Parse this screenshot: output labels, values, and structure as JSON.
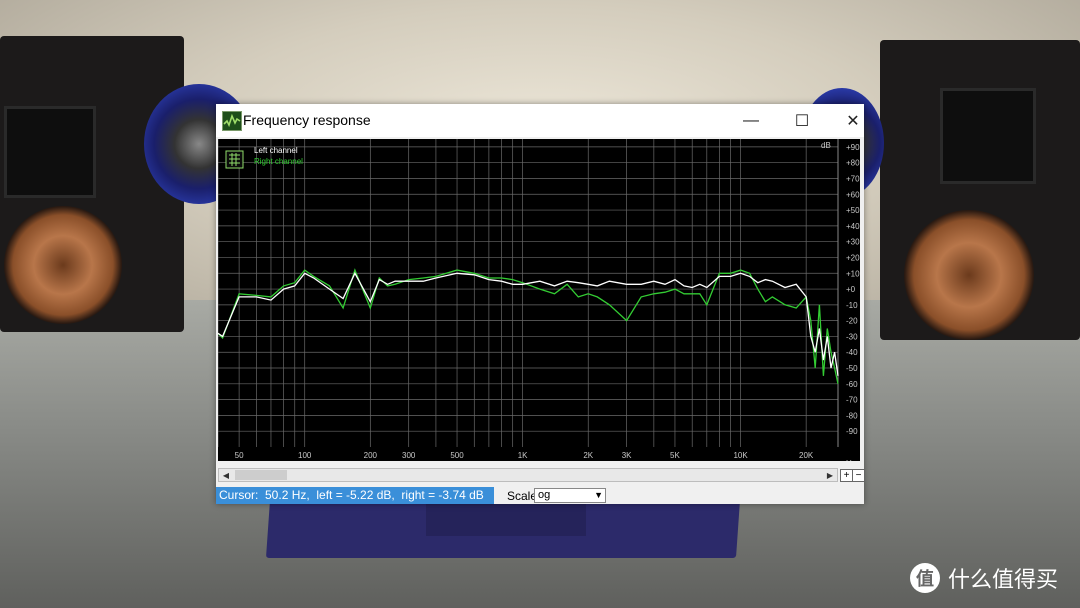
{
  "window": {
    "title": "Frequency response",
    "minimize_glyph": "—",
    "maximize_glyph": "☐",
    "close_glyph": "✕",
    "icon": "frequency-graph-icon"
  },
  "status": {
    "cursor_text": "Cursor:  50.2 Hz,  left = -5.22 dB,  right = -3.74 dB",
    "scale_label": "Scale",
    "scale_value": "og"
  },
  "watermark": {
    "logo": "值",
    "text": "什么值得买"
  },
  "colors": {
    "left_channel": "#ffffff",
    "right_channel": "#33cc33",
    "grid": "#6a6a6a",
    "background": "#000000",
    "status_highlight": "#3a8fd9"
  },
  "chart_data": {
    "type": "line",
    "x_scale": "log",
    "xlim": [
      40,
      28000
    ],
    "ylim": [
      -100,
      95
    ],
    "x_unit": "Hz",
    "y_unit": "dB",
    "x_tick_labels": [
      {
        "v": 50,
        "t": "50"
      },
      {
        "v": 100,
        "t": "100"
      },
      {
        "v": 200,
        "t": "200"
      },
      {
        "v": 300,
        "t": "300"
      },
      {
        "v": 500,
        "t": "500"
      },
      {
        "v": 1000,
        "t": "1K"
      },
      {
        "v": 2000,
        "t": "2K"
      },
      {
        "v": 3000,
        "t": "3K"
      },
      {
        "v": 5000,
        "t": "5K"
      },
      {
        "v": 10000,
        "t": "10K"
      },
      {
        "v": 20000,
        "t": "20K"
      }
    ],
    "y_ticks": [
      90,
      80,
      70,
      60,
      50,
      40,
      30,
      20,
      10,
      0,
      -10,
      -20,
      -30,
      -40,
      -50,
      -60,
      -70,
      -80,
      -90
    ],
    "y_tick_labels": [
      "+90",
      "+80",
      "+70",
      "+60",
      "+50",
      "+40",
      "+30",
      "+20",
      "+10",
      "+0",
      "-10",
      "-20",
      "-30",
      "-40",
      "-50",
      "-60",
      "-70",
      "-80",
      "-90"
    ],
    "grid": true,
    "legend_position": "top-left",
    "series": [
      {
        "name": "Left channel",
        "x": [
          40,
          42,
          50,
          60,
          70,
          80,
          90,
          100,
          110,
          130,
          150,
          170,
          200,
          220,
          240,
          260,
          300,
          350,
          400,
          500,
          600,
          700,
          800,
          900,
          1000,
          1200,
          1400,
          1600,
          1800,
          2000,
          2200,
          2500,
          3000,
          3500,
          4000,
          4500,
          5000,
          5500,
          6000,
          6500,
          7000,
          8000,
          9000,
          10000,
          11000,
          12000,
          13000,
          14000,
          16000,
          18000,
          20000,
          21000,
          22000,
          23000,
          24000,
          25000,
          26000,
          27000,
          28000
        ],
        "y": [
          -28,
          -30,
          -5,
          -5,
          -7,
          0,
          2,
          10,
          7,
          0,
          -6,
          10,
          -8,
          6,
          3,
          5,
          5,
          5,
          7,
          10,
          9,
          6,
          5,
          3,
          3,
          5,
          2,
          5,
          4,
          3,
          2,
          5,
          3,
          3,
          5,
          3,
          6,
          2,
          1,
          3,
          1,
          8,
          8,
          10,
          8,
          4,
          6,
          5,
          1,
          3,
          -5,
          -30,
          -40,
          -25,
          -45,
          -30,
          -50,
          -40,
          -55
        ]
      },
      {
        "name": "Right channel",
        "x": [
          40,
          42,
          50,
          60,
          70,
          80,
          90,
          100,
          110,
          130,
          150,
          170,
          200,
          220,
          240,
          260,
          300,
          350,
          400,
          500,
          600,
          700,
          800,
          900,
          1000,
          1200,
          1400,
          1600,
          1800,
          2000,
          2200,
          2500,
          3000,
          3500,
          4000,
          4500,
          5000,
          5500,
          6000,
          6500,
          7000,
          8000,
          9000,
          10000,
          11000,
          12000,
          13000,
          14000,
          16000,
          18000,
          20000,
          21000,
          22000,
          23000,
          24000,
          25000,
          26000,
          27000,
          28000
        ],
        "y": [
          -28,
          -31,
          -3,
          -4,
          -5,
          2,
          4,
          12,
          8,
          2,
          -12,
          12,
          -12,
          7,
          2,
          3,
          6,
          7,
          8,
          12,
          10,
          7,
          7,
          6,
          4,
          0,
          -3,
          3,
          -5,
          -3,
          -5,
          -10,
          -20,
          -5,
          -3,
          -2,
          0,
          -3,
          -3,
          -3,
          -10,
          10,
          10,
          12,
          10,
          0,
          -8,
          -5,
          -10,
          -12,
          -5,
          -20,
          -50,
          -10,
          -55,
          -25,
          -40,
          -50,
          -60
        ]
      }
    ]
  }
}
